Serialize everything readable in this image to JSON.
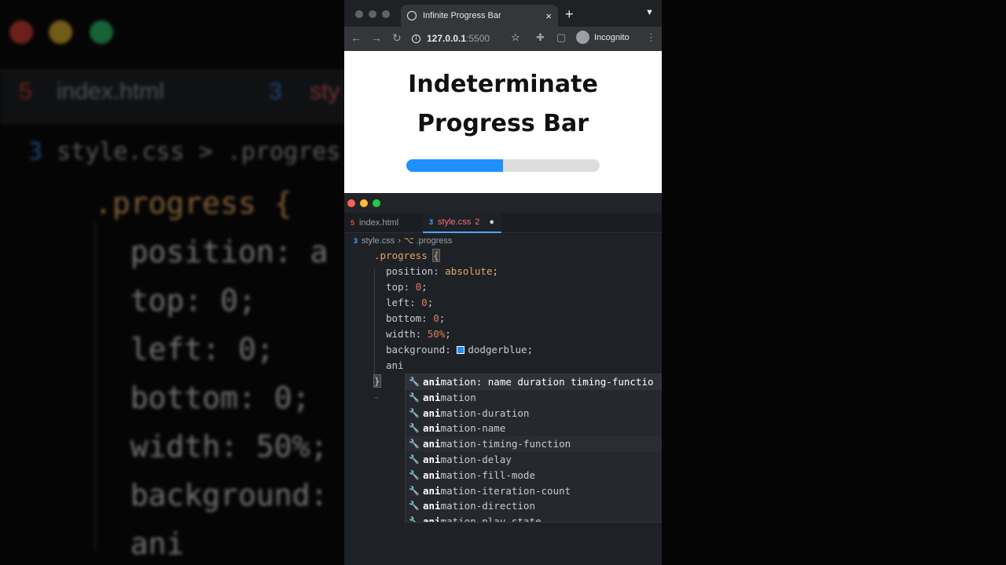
{
  "background": {
    "tabs": [
      "index.html",
      "sty"
    ],
    "breadcrumb": [
      "style.css",
      ">",
      ".progres"
    ],
    "code_lines": [
      ".progress {",
      "  position: a",
      "  top: 0;",
      "  left: 0;",
      "  bottom: 0;",
      "  width: 50%;",
      "  background:",
      "  ani"
    ]
  },
  "browser": {
    "tab_title": "Infinite Progress Bar",
    "tab_close": "×",
    "new_tab": "+",
    "url_host": "127.0.0.1",
    "url_port": ":5500",
    "incognito_label": "Incognito",
    "page_title_line1": "Indeterminate",
    "page_title_line2": "Progress Bar",
    "progress_fraction": 0.5,
    "progress_color": "#1e90ff",
    "track_color": "#dddddd"
  },
  "editor": {
    "tabs": [
      {
        "label": "index.html",
        "icon": "html5-icon"
      },
      {
        "label": "style.css",
        "badge": "2",
        "icon": "css3-icon"
      }
    ],
    "breadcrumb_file": "style.css",
    "breadcrumb_symbol": ".progress",
    "code": {
      "selector": ".progress",
      "open_brace": "{",
      "p1": "position",
      "v1": "absolute",
      "p2": "top",
      "v2": "0",
      "p3": "left",
      "v3": "0",
      "p4": "bottom",
      "v4": "0",
      "p5": "width",
      "v5": "50%",
      "p6": "background",
      "v6": "dodgerblue",
      "typing": "ani",
      "close_brace": "}",
      "tilde": "~"
    },
    "suggestions": [
      {
        "match": "ani",
        "rest": "mation: name duration timing-functio"
      },
      {
        "match": "ani",
        "rest": "mation"
      },
      {
        "match": "ani",
        "rest": "mation-duration"
      },
      {
        "match": "ani",
        "rest": "mation-name"
      },
      {
        "match": "ani",
        "rest": "mation-timing-function"
      },
      {
        "match": "ani",
        "rest": "mation-delay"
      },
      {
        "match": "ani",
        "rest": "mation-fill-mode"
      },
      {
        "match": "ani",
        "rest": "mation-iteration-count"
      },
      {
        "match": "ani",
        "rest": "mation-direction"
      },
      {
        "match": "ani",
        "rest": "mation-play-state"
      }
    ]
  }
}
